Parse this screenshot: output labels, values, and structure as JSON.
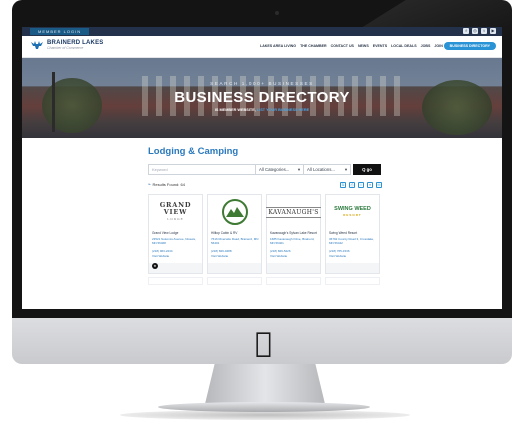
{
  "topbar": {
    "member_login": "MEMBER LOGIN",
    "social_icons": [
      "facebook-icon",
      "instagram-icon",
      "twitter-icon",
      "youtube-icon"
    ]
  },
  "header": {
    "logo_title": "BRAINERD LAKES",
    "logo_sub": "Chamber of Commerce",
    "nav": [
      "LAKES AREA LIVING",
      "THE CHAMBER",
      "CONTACT US",
      "NEWS",
      "EVENTS",
      "LOCAL DEALS",
      "JOBS",
      "JOIN"
    ],
    "cta": "BUSINESS DIRECTORY"
  },
  "hero": {
    "kicker": "SEARCH 1,000+ BUSINESSES",
    "title": "BUSINESS DIRECTORY",
    "sub_prefix": "IS MEMBER WEBSITE,",
    "sub_link": "LIST YOUR BUSINESS HERE"
  },
  "directory": {
    "title": "Lodging & Camping",
    "keyword_placeholder": "Keyword",
    "category_value": "All Categories...",
    "location_value": "All Locations...",
    "go_label": "Q go",
    "results_label": "Results Found:",
    "results_count": "64",
    "view_icons": [
      "sort-icon",
      "print-icon",
      "map-pin-icon",
      "list-icon",
      "email-icon"
    ],
    "listings": [
      {
        "logo_text": "GRAND VIEW",
        "logo_sub": "LODGE",
        "name": "Grand View Lodge",
        "address": "23521 Nokomis Avenue, Nisswa, MN 56468",
        "phone": "(218) 963-2234",
        "website": "Visit Website"
      },
      {
        "logo_text": "Hilltop",
        "logo_sub": "",
        "name": "Hilltop Cabin & RV",
        "address": "7616 Riverside Road, Brainerd, MN 56401",
        "phone": "(218) 829-0488",
        "website": "Visit Website"
      },
      {
        "logo_text": "KAVANAUGH'S",
        "logo_sub": "",
        "name": "Kavanaugh's Sylvan Lake Resort",
        "address": "1685 Kavanaugh Drive, Brainerd, MN 56401",
        "phone": "(218) 829-5226",
        "website": "Visit Website"
      },
      {
        "logo_text": "SWING WEED",
        "logo_sub": "RESORT",
        "name": "Swing Weed Resort",
        "address": "36792 County Road 3, Crosslake, MN 56442",
        "phone": "(218) 765-1536",
        "website": "Visit Website"
      }
    ]
  },
  "colors": {
    "brand_blue": "#2a79bd",
    "cta_blue": "#2a93d5",
    "topbar": "#23324a"
  }
}
